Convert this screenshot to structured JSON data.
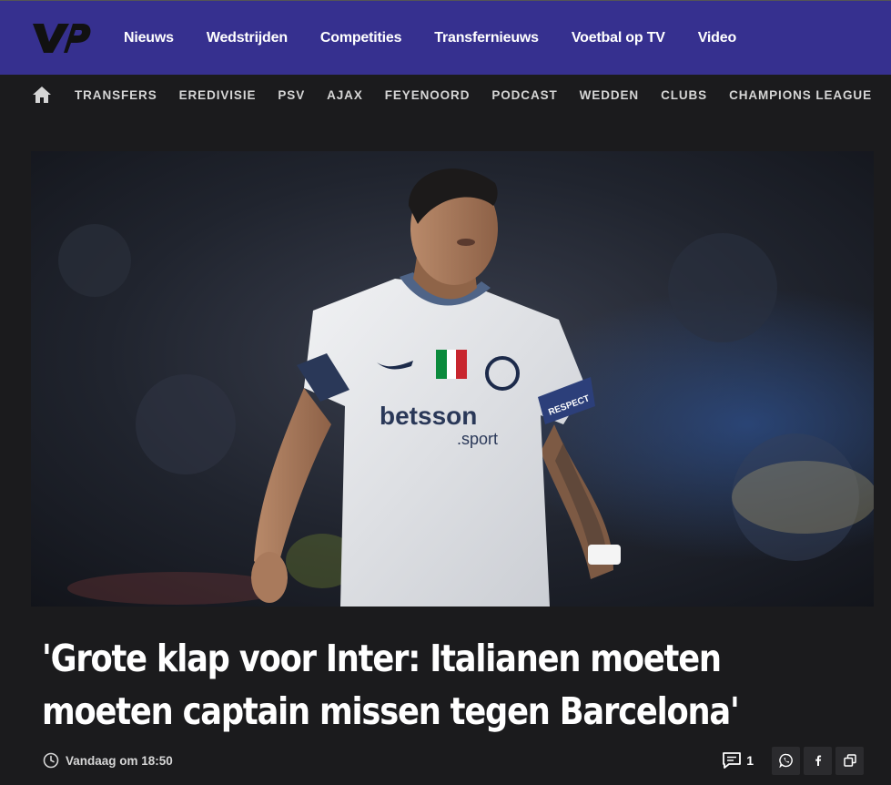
{
  "brand": {
    "logo_text": "VP"
  },
  "main_nav": [
    "Nieuws",
    "Wedstrijden",
    "Competities",
    "Transfernieuws",
    "Voetbal op TV",
    "Video"
  ],
  "sub_nav": [
    "TRANSFERS",
    "EREDIVISIE",
    "PSV",
    "AJAX",
    "FEYENOORD",
    "PODCAST",
    "WEDDEN",
    "CLUBS",
    "CHAMPIONS LEAGUE"
  ],
  "article": {
    "image": {
      "shirt_sponsor": "betsson",
      "shirt_sponsor_sub": ".sport",
      "armband_text": "RESPECT"
    },
    "headline_line1": "'Grote klap voor Inter: Italianen moeten",
    "headline_line2": "moeten captain missen tegen Barcelona'",
    "time": "Vandaag om 18:50",
    "comment_count": "1"
  },
  "icons": {
    "home": "home-icon",
    "clock": "clock-icon",
    "comments": "comment-icon",
    "share": [
      "whatsapp-icon",
      "facebook-icon",
      "copy-link-icon"
    ]
  },
  "colors": {
    "topbar": "#36308f",
    "background": "#1b1b1d",
    "subnav_text": "#d6d6d6"
  }
}
